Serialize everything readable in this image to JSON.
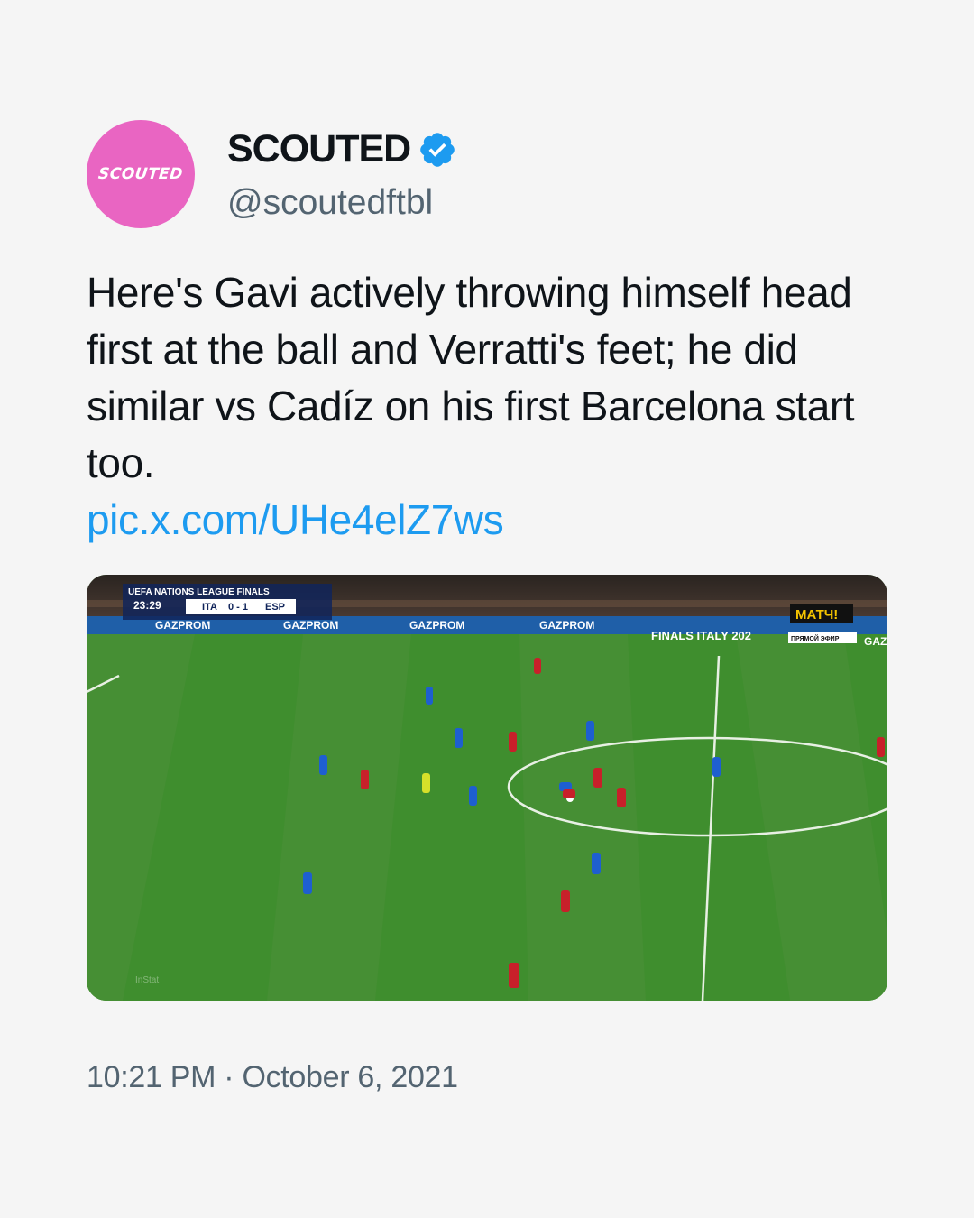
{
  "author": {
    "display_name": "SCOUTED",
    "handle": "@scoutedftbl",
    "avatar_text": "SCOUTED",
    "avatar_color": "#e965c2",
    "verified": true,
    "verified_color": "#1d9bf0"
  },
  "tweet": {
    "text": "Here's Gavi actively throwing himself head first at the ball and Verratti's feet; he did similar vs Cadíz on his first Barcelona start too.",
    "link": "pic.x.com/UHe4elZ7ws",
    "link_color": "#1d9bf0"
  },
  "media": {
    "scoreboard": {
      "competition": "UEFA NATIONS LEAGUE FINALS",
      "clock": "23:29",
      "home": "ITA",
      "score": "0 - 1",
      "away": "ESP"
    },
    "broadcaster": "МАТЧ!",
    "live_label": "ПРЯМОЙ ЭФИР",
    "ad_texts": [
      "GAZPROM",
      "GAZPROM",
      "GAZPROM",
      "GAZPROM",
      "GAZ"
    ],
    "banner_text": "FINALS ITALY 202",
    "watermark": "InStat"
  },
  "timestamp": "10:21 PM · October 6, 2021"
}
